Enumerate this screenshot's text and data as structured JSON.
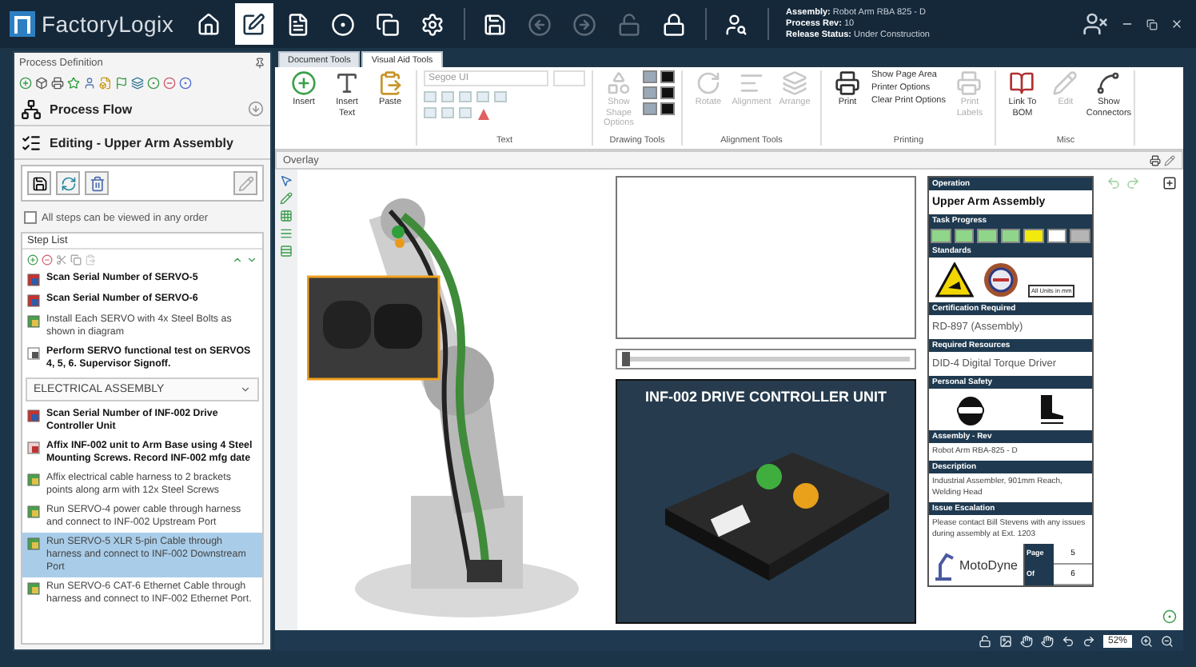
{
  "app": {
    "name": "FactoryLogix"
  },
  "nav": [
    {
      "selected": false,
      "disabled": false
    },
    {
      "selected": true,
      "disabled": false
    },
    {
      "selected": false,
      "disabled": false
    },
    {
      "selected": false,
      "disabled": false
    },
    {
      "selected": false,
      "disabled": false
    },
    {
      "selected": false,
      "disabled": false
    },
    {
      "selected": false,
      "disabled": false
    },
    {
      "selected": false,
      "disabled": true
    },
    {
      "selected": false,
      "disabled": true
    },
    {
      "selected": false,
      "disabled": true
    },
    {
      "selected": false,
      "disabled": false
    },
    {
      "selected": false,
      "disabled": false
    }
  ],
  "header": [
    {
      "label": "Assembly:",
      "value": "Robot Arm RBA 825 - D"
    },
    {
      "label": "Process Rev:",
      "value": "10"
    },
    {
      "label": "Release Status:",
      "value": "Under Construction"
    }
  ],
  "left_panel": {
    "title": "Process Definition",
    "flow_title": "Process Flow",
    "editing_title": "Editing - Upper Arm Assembly",
    "any_order": {
      "label": "All steps can be viewed in any order",
      "checked": false
    },
    "step_list_title": "Step List",
    "steps": [
      {
        "kind": "scan",
        "text": "Scan Serial Number of SERVO-5",
        "bold": true,
        "selected": false
      },
      {
        "kind": "scan",
        "text": "Scan Serial Number of SERVO-6",
        "bold": true,
        "selected": false
      },
      {
        "kind": "install",
        "text": "Install Each SERVO with 4x Steel Bolts as shown in diagram",
        "bold": false,
        "selected": false
      },
      {
        "kind": "inspect",
        "text": "Perform SERVO functional test on SERVOS 4, 5, 6. Supervisor Signoff.",
        "bold": true,
        "selected": false
      },
      {
        "kind": "group",
        "text": "ELECTRICAL ASSEMBLY"
      },
      {
        "kind": "scan",
        "text": "Scan Serial Number of INF-002 Drive Controller Unit",
        "bold": true,
        "selected": false
      },
      {
        "kind": "label",
        "text": "Affix INF-002 unit to Arm Base using 4 Steel Mounting Screws. Record INF-002 mfg date",
        "bold": true,
        "selected": false
      },
      {
        "kind": "install",
        "text": "Affix electrical cable harness to 2 brackets points along arm with 12x Steel Screws",
        "bold": false,
        "selected": false
      },
      {
        "kind": "install",
        "text": "Run SERVO-4 power cable through harness and connect to INF-002 Upstream Port",
        "bold": false,
        "selected": false
      },
      {
        "kind": "install",
        "text": "Run SERVO-5 XLR 5-pin Cable through harness and connect to INF-002 Downstream Port",
        "bold": false,
        "selected": true
      },
      {
        "kind": "install",
        "text": "Run SERVO-6 CAT-6 Ethernet Cable through harness and connect to INF-002 Ethernet Port.",
        "bold": false,
        "selected": false
      }
    ]
  },
  "ribbon": {
    "tabs": [
      {
        "label": "Document Tools",
        "selected": false
      },
      {
        "label": "Visual Aid Tools",
        "selected": true
      }
    ],
    "font": {
      "value": "Segoe UI",
      "disabled": true
    },
    "groups": [
      {
        "kind": "buttons",
        "buttons": [
          {
            "label": "Insert",
            "disabled": false
          },
          {
            "label": "Insert Text",
            "disabled": false
          },
          {
            "label": "Paste",
            "disabled": false
          }
        ]
      },
      {
        "kind": "font",
        "label": "Text"
      },
      {
        "kind": "shapes",
        "label": "Drawing Tools",
        "buttons": [
          {
            "label": "Show Shape Options",
            "disabled": true
          }
        ]
      },
      {
        "kind": "buttons",
        "label": "Alignment Tools",
        "buttons": [
          {
            "label": "Rotate",
            "disabled": true
          },
          {
            "label": "Alignment",
            "disabled": true
          },
          {
            "label": "Arrange",
            "disabled": true
          }
        ]
      },
      {
        "kind": "printing",
        "label": "Printing",
        "buttons": [
          {
            "label": "Print",
            "disabled": false
          },
          {
            "label": "Print Labels",
            "disabled": true
          }
        ],
        "links": [
          {
            "label": "Show Page Area"
          },
          {
            "label": "Printer Options"
          },
          {
            "label": "Clear Print Options"
          }
        ]
      },
      {
        "kind": "buttons",
        "label": "Misc",
        "buttons": [
          {
            "label": "Link To BOM",
            "disabled": false
          },
          {
            "label": "Edit",
            "disabled": true
          },
          {
            "label": "Show Connectors",
            "disabled": false
          }
        ]
      }
    ]
  },
  "overlay": {
    "label": "Overlay"
  },
  "media_slider": {
    "level": 0
  },
  "device": {
    "title": "INF-002 DRIVE CONTROLLER UNIT"
  },
  "sheet": [
    {
      "kind": "text",
      "heading": "Operation",
      "value": "Upper Arm Assembly",
      "bold": true
    },
    {
      "kind": "progress",
      "heading": "Task Progress",
      "segments": [
        {
          "color": "#8fd68a"
        },
        {
          "color": "#8fd68a"
        },
        {
          "color": "#8fd68a"
        },
        {
          "color": "#8fd68a"
        },
        {
          "color": "#f2ea0c"
        },
        {
          "color": "#ffffff"
        },
        {
          "color": "#b4b4b4"
        }
      ]
    },
    {
      "kind": "standards",
      "heading": "Standards",
      "note": "All Units in mm"
    },
    {
      "kind": "text",
      "heading": "Certification Required",
      "value": "RD-897 (Assembly)",
      "bold": false
    },
    {
      "kind": "text",
      "heading": "Required Resources",
      "value": "DID-4 Digital Torque Driver",
      "bold": false
    },
    {
      "kind": "safety",
      "heading": "Personal Safety"
    },
    {
      "kind": "small",
      "heading": "Assembly - Rev",
      "value": "Robot Arm RBA-825 - D"
    },
    {
      "kind": "small",
      "heading": "Description",
      "value": "Industrial Assembler, 901mm Reach, Welding Head"
    },
    {
      "kind": "small",
      "heading": "Issue Escalation",
      "value": "Please contact Bill Stevens with any issues during assembly at Ext. 1203"
    }
  ],
  "sheet_footer": {
    "logo": "MotoDyne",
    "page_label": "Page",
    "page": "5",
    "of_label": "Of",
    "total": "6"
  },
  "zoom": {
    "value": "52%"
  }
}
